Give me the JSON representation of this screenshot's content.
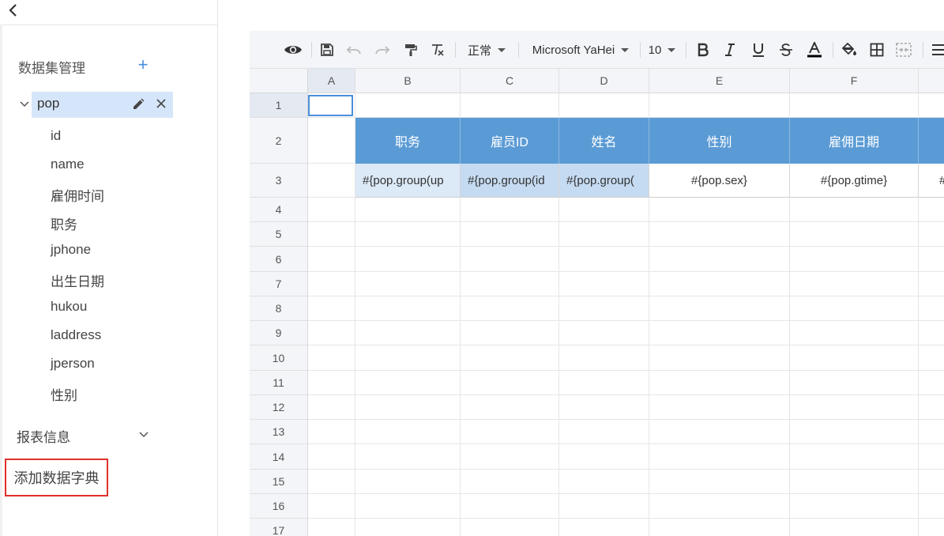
{
  "left_panel": {
    "dataset_section": {
      "title": "数据集管理",
      "add_symbol": "+"
    },
    "dataset": {
      "name": "pop",
      "fields": [
        "id",
        "name",
        "雇佣时间",
        "职务",
        "jphone",
        "出生日期",
        "hukou",
        "laddress",
        "jperson",
        "性别"
      ]
    },
    "report_info": {
      "label": "报表信息"
    },
    "add_dictionary": {
      "label": "添加数据字典"
    }
  },
  "toolbar": {
    "style_select": "正常",
    "font_select": "Microsoft YaHei",
    "size_select": "10",
    "icons": [
      "preview-eye-icon",
      "save-icon",
      "undo-icon",
      "redo-icon",
      "format-painter-icon",
      "clear-format-icon",
      "bold-icon",
      "italic-icon",
      "underline-icon",
      "strikethrough-icon",
      "font-color-icon",
      "fill-color-icon",
      "borders-icon",
      "merge-cells-icon",
      "align-icon"
    ],
    "font_color": "#000000"
  },
  "grid": {
    "columns": [
      "A",
      "B",
      "C",
      "D",
      "E",
      "F"
    ],
    "rows": [
      "1",
      "2",
      "3",
      "4",
      "5",
      "6",
      "7",
      "8",
      "9",
      "10",
      "11",
      "12",
      "13",
      "14",
      "15",
      "16",
      "17"
    ],
    "header_row": [
      "职务",
      "雇员ID",
      "姓名",
      "性别",
      "雇佣日期",
      ""
    ],
    "field_row": [
      "#{pop.group(up",
      "#{pop.group(id",
      "#{pop.group(",
      "#{pop.sex}",
      "#{pop.gtime}",
      "#"
    ],
    "colors": {
      "header_fill": "#5b9bd5",
      "highlight_fill": "#c5dbf1",
      "light_fill": "#dce9f6",
      "selection": "#4a8fdc"
    }
  }
}
